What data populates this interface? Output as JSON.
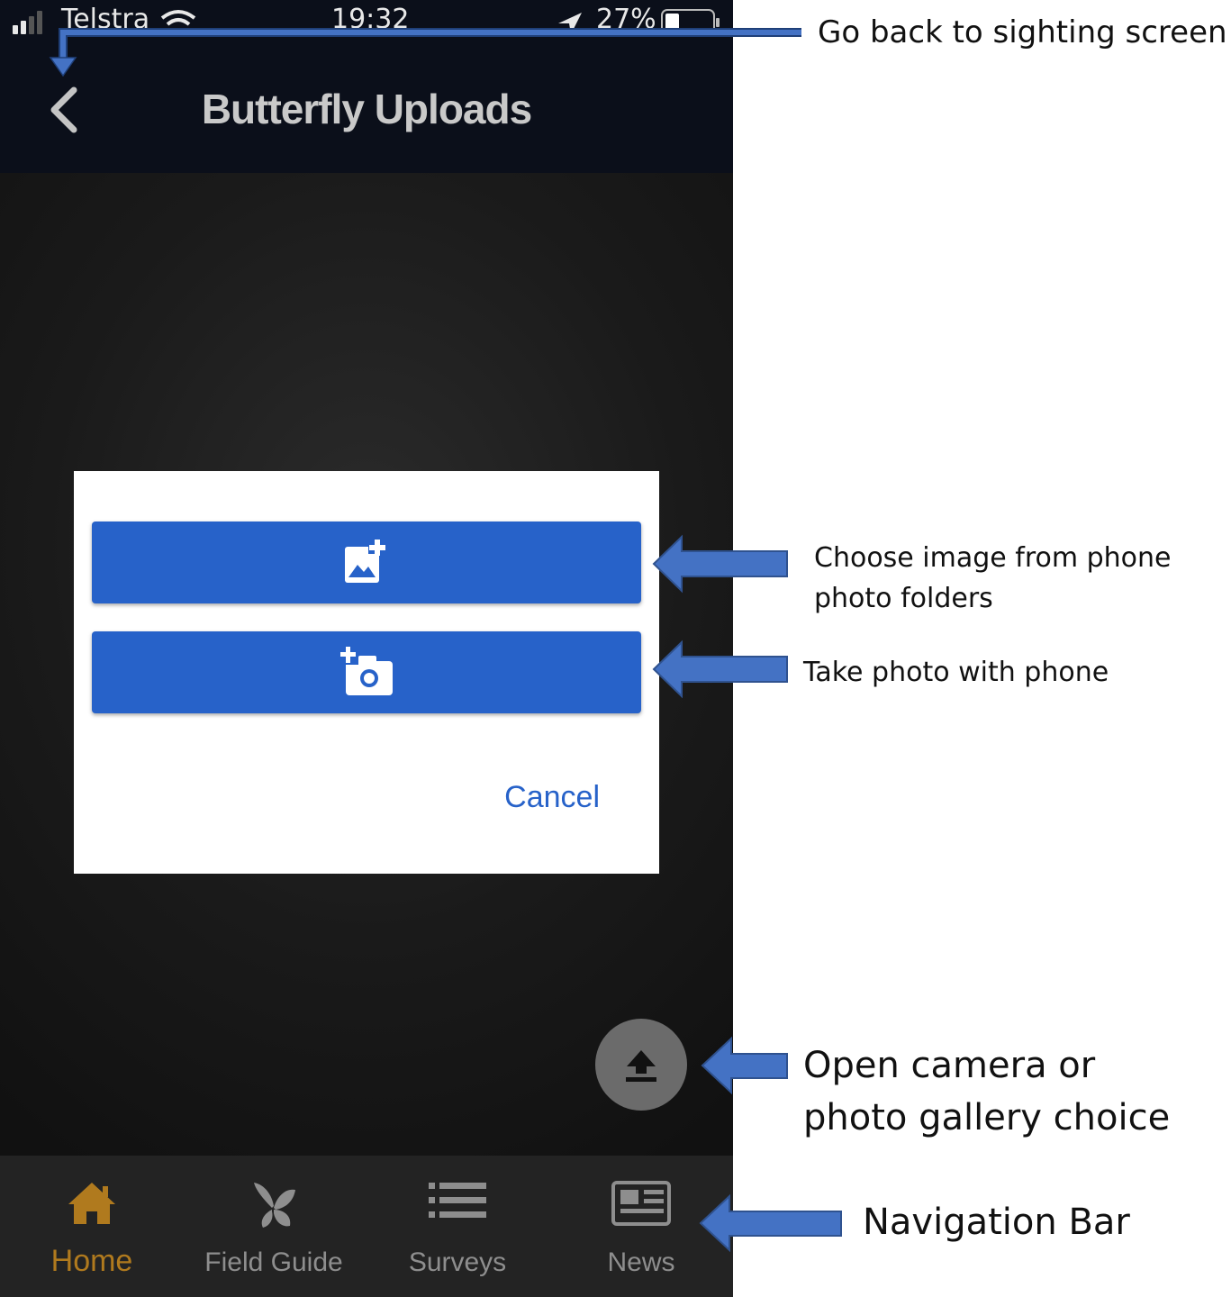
{
  "status_bar": {
    "carrier": "Telstra",
    "time": "19:32",
    "battery": "27%"
  },
  "header": {
    "title": "Butterfly Uploads"
  },
  "dialog": {
    "gallery_button_icon": "add-photo-icon",
    "camera_button_icon": "add-camera-icon",
    "cancel_label": "Cancel"
  },
  "fab": {
    "icon": "upload-icon"
  },
  "bottom_nav": {
    "items": [
      {
        "label": "Home",
        "icon": "home-icon",
        "active": true
      },
      {
        "label": "Field Guide",
        "icon": "butterfly-icon",
        "active": false
      },
      {
        "label": "Surveys",
        "icon": "list-icon",
        "active": false
      },
      {
        "label": "News",
        "icon": "newspaper-icon",
        "active": false
      }
    ]
  },
  "annotations": {
    "back": "Go back to sighting screen",
    "gallery_line1": "Choose image from phone",
    "gallery_line2": "photo folders",
    "camera": "Take photo with phone",
    "fab_line1": "Open camera or",
    "fab_line2": "photo gallery choice",
    "nav": "Navigation Bar"
  },
  "colors": {
    "accent": "#2762c9",
    "active_nav": "#b07a1e",
    "arrow": "#4472c4",
    "header_bg": "#0b0f1a"
  }
}
